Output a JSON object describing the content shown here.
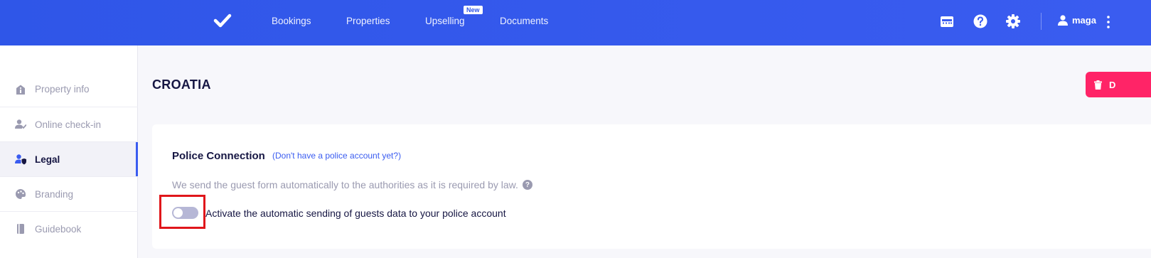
{
  "topbar": {
    "logo_icon": "check-icon",
    "nav": [
      {
        "label": "Bookings"
      },
      {
        "label": "Properties"
      },
      {
        "label": "Upselling",
        "badge": "New"
      },
      {
        "label": "Documents"
      }
    ],
    "icons": [
      "calendar-board-icon",
      "help-icon",
      "gear-icon",
      "user-icon",
      "kebab-menu-icon"
    ],
    "user_name": "maga"
  },
  "sidebar": {
    "items": [
      {
        "label": "Property info",
        "icon": "info-house-icon",
        "active": false
      },
      {
        "label": "Online check-in",
        "icon": "user-check-icon",
        "active": false
      },
      {
        "label": "Legal",
        "icon": "user-shield-icon",
        "active": true
      },
      {
        "label": "Branding",
        "icon": "palette-icon",
        "active": false
      },
      {
        "label": "Guidebook",
        "icon": "book-icon",
        "active": false
      }
    ]
  },
  "main": {
    "title": "CROATIA",
    "delete_label": "D",
    "card": {
      "title": "Police Connection",
      "link": "(Don't have a police account yet?)",
      "description": "We send the guest form automatically to the authorities as it is required by law.",
      "help_glyph": "?",
      "toggle_label": "Activate the automatic sending of guests data to your police account",
      "toggle_on": false
    }
  },
  "colors": {
    "topbar": "#3a5cf0",
    "accent": "#3a5cf0",
    "danger": "#ff2467",
    "text_dark": "#161643",
    "text_muted": "#9a9ab0",
    "highlight": "#e0161b"
  }
}
